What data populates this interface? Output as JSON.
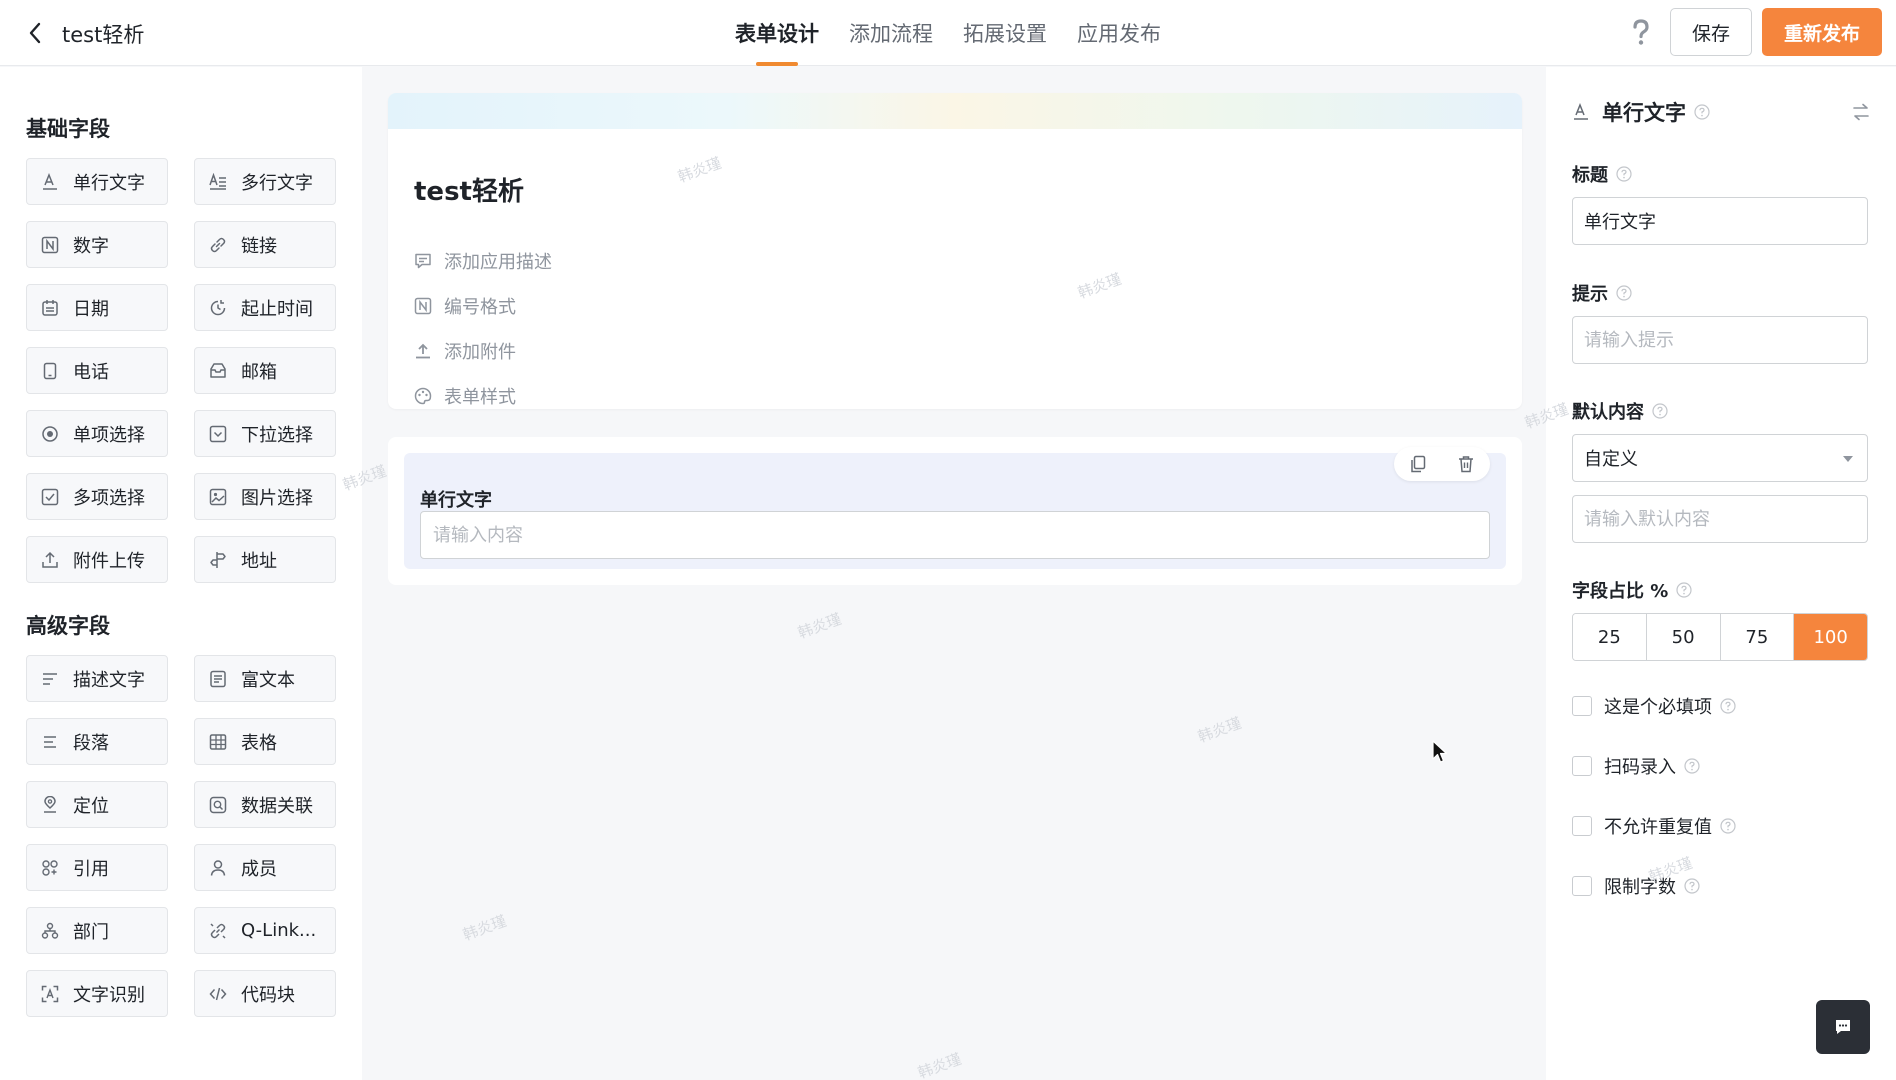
{
  "header": {
    "title": "test轻析",
    "tabs": [
      "表单设计",
      "添加流程",
      "拓展设置",
      "应用发布"
    ],
    "active_tab": "表单设计",
    "save_label": "保存",
    "publish_label": "重新发布"
  },
  "left": {
    "basic_title": "基础字段",
    "basic_fields": [
      {
        "label": "单行文字",
        "icon": "text-icon"
      },
      {
        "label": "多行文字",
        "icon": "multiline-text-icon"
      },
      {
        "label": "数字",
        "icon": "number-icon"
      },
      {
        "label": "链接",
        "icon": "link-icon"
      },
      {
        "label": "日期",
        "icon": "calendar-icon"
      },
      {
        "label": "起止时间",
        "icon": "time-range-icon"
      },
      {
        "label": "电话",
        "icon": "phone-icon"
      },
      {
        "label": "邮箱",
        "icon": "mail-icon"
      },
      {
        "label": "单项选择",
        "icon": "radio-icon"
      },
      {
        "label": "下拉选择",
        "icon": "dropdown-icon"
      },
      {
        "label": "多项选择",
        "icon": "checkbox-icon"
      },
      {
        "label": "图片选择",
        "icon": "image-icon"
      },
      {
        "label": "附件上传",
        "icon": "upload-icon"
      },
      {
        "label": "地址",
        "icon": "address-icon"
      }
    ],
    "advanced_title": "高级字段",
    "advanced_fields": [
      {
        "label": "描述文字",
        "icon": "description-icon"
      },
      {
        "label": "富文本",
        "icon": "rich-text-icon"
      },
      {
        "label": "段落",
        "icon": "paragraph-icon"
      },
      {
        "label": "表格",
        "icon": "table-icon"
      },
      {
        "label": "定位",
        "icon": "location-icon"
      },
      {
        "label": "数据关联",
        "icon": "data-link-icon"
      },
      {
        "label": "引用",
        "icon": "reference-icon"
      },
      {
        "label": "成员",
        "icon": "member-icon"
      },
      {
        "label": "部门",
        "icon": "department-icon"
      },
      {
        "label": "Q-Link...",
        "icon": "qlink-icon"
      },
      {
        "label": "文字识别",
        "icon": "ocr-icon"
      },
      {
        "label": "代码块",
        "icon": "code-icon"
      }
    ]
  },
  "form": {
    "name": "test轻析",
    "options": [
      {
        "label": "添加应用描述",
        "icon": "comment-icon"
      },
      {
        "label": "编号格式",
        "icon": "number-format-icon"
      },
      {
        "label": "添加附件",
        "icon": "attach-icon"
      },
      {
        "label": "表单样式",
        "icon": "palette-icon"
      }
    ],
    "selected_field": {
      "label": "单行文字",
      "placeholder": "请输入内容"
    },
    "watermark": "韩炎瑾"
  },
  "panel": {
    "title": "单行文字",
    "title_label": "标题",
    "title_value": "单行文字",
    "hint_label": "提示",
    "hint_placeholder": "请输入提示",
    "default_label": "默认内容",
    "default_select": "自定义",
    "default_placeholder": "请输入默认内容",
    "width_label": "字段占比 %",
    "width_options": [
      "25",
      "50",
      "75",
      "100"
    ],
    "width_selected": "100",
    "checks": [
      "这是个必填项",
      "扫码录入",
      "不允许重复值",
      "限制字数"
    ]
  },
  "colors": {
    "accent": "#f5853d",
    "selected_field_bg": "#eef1fb"
  }
}
